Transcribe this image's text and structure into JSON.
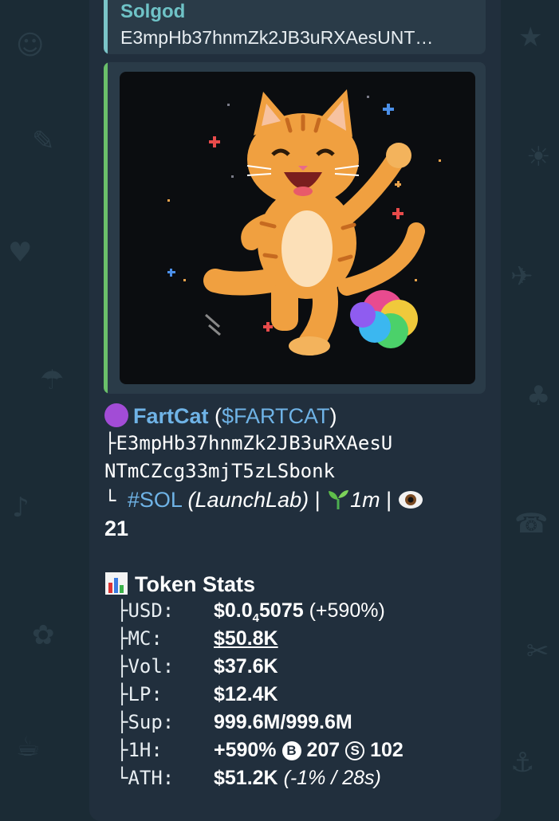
{
  "reply": {
    "sender": "Solgod",
    "preview": "E3mpHb37hnmZk2JB3uRXAesUNT…"
  },
  "token": {
    "name": "FartCat",
    "symbol_open": " (",
    "symbol": "$FARTCAT",
    "symbol_close": ")",
    "address_line1": "├E3mpHb37hnmZk2JB3uRXAesU",
    "address_line2": "NTmCZcg33mjT5zLSbonk",
    "tag_prefix": "└ ",
    "chain_tag": "#SOL",
    "launchpad": "(LaunchLab)",
    "separator1": " | ",
    "age": "1m",
    "separator2": " | ",
    "views": "21"
  },
  "stats": {
    "title": "Token Stats",
    "rows": [
      {
        "label": "├USD:",
        "value": "$0.0",
        "sub": "4",
        "value_rest": "5075",
        "extra": " (+590%)"
      },
      {
        "label": "├MC:",
        "value": "$50.8K"
      },
      {
        "label": "├Vol:",
        "value": "$37.6K"
      },
      {
        "label": "├LP:",
        "value": "$12.4K"
      },
      {
        "label": "├Sup:",
        "value": "999.6M/999.6M"
      },
      {
        "label": "├1H:",
        "value": "+590%",
        "b_symbol": "B",
        "b_count": "207",
        "s_symbol": "S",
        "s_count": "102"
      },
      {
        "label": "└ATH:",
        "value": "$51.2K",
        "extra": "(-1% / 28s)"
      }
    ]
  },
  "icons": {
    "purple_circle": "purple-circle-icon",
    "seedling": "seedling-icon",
    "eye": "eye-icon",
    "bar_chart": "bar-chart-icon"
  },
  "colors": {
    "background": "#1b2b35",
    "bubble": "#212f3d",
    "link": "#6fb3e6",
    "reply_accent": "#7bc4c8",
    "media_accent": "#6ac06a"
  }
}
